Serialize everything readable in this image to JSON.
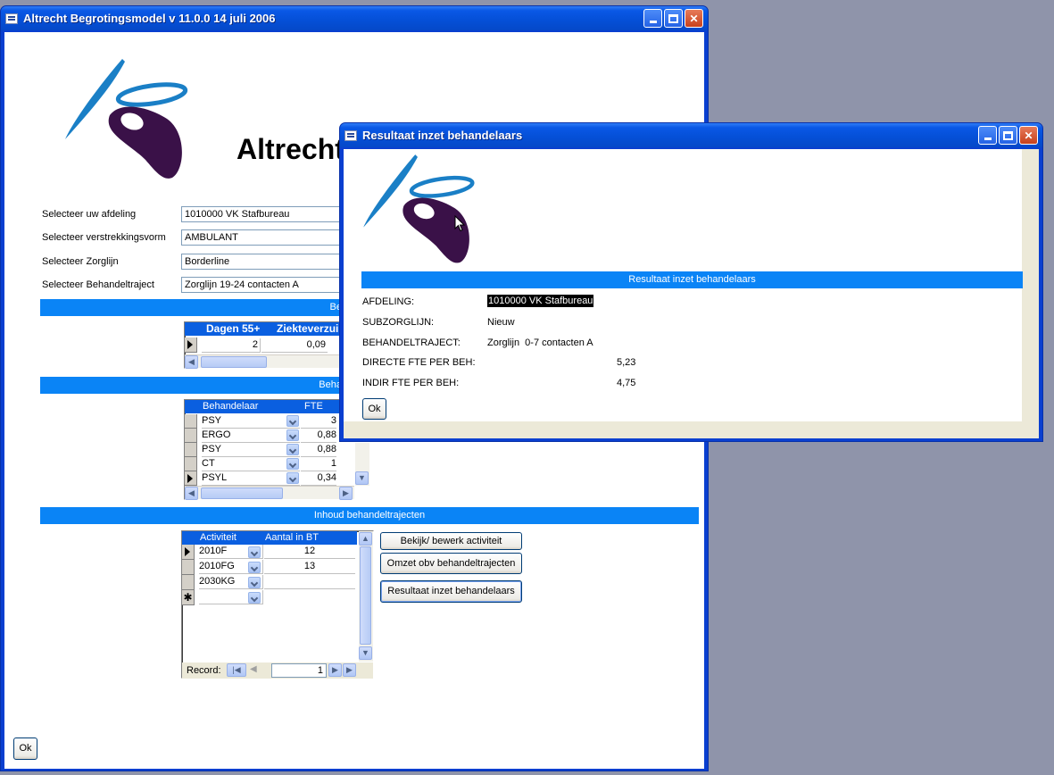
{
  "main_window": {
    "title": "Altrecht Begrotingsmodel v 11.0.0 14 juli 2006",
    "heading": "Altrecht",
    "form": {
      "afdeling_label": "Selecteer uw afdeling",
      "afdeling_value": "1010000 VK Stafbureau",
      "verstrekkingsvorm_label": "Selecteer verstrekkingsvorm",
      "verstrekkingsvorm_value": "AMBULANT",
      "zorglijn_label": "Selecteer Zorglijn",
      "zorglijn_value": "Borderline",
      "behandeltraject_label": "Selecteer Behandeltraject",
      "behandeltraject_value": "Zorglijn  19-24 contacten A"
    },
    "section1_title": "Be",
    "grid1": {
      "headers": [
        "Dagen 55+",
        "Ziekteverzui"
      ],
      "row": [
        "2",
        "0,09"
      ]
    },
    "section2_title": "Beha",
    "grid2": {
      "headers": [
        "Behandelaar",
        "FTE"
      ],
      "rows": [
        {
          "behandelaar": "PSY",
          "fte": "3"
        },
        {
          "behandelaar": "ERGO",
          "fte": "0,88"
        },
        {
          "behandelaar": "PSY",
          "fte": "0,88"
        },
        {
          "behandelaar": "CT",
          "fte": "1"
        },
        {
          "behandelaar": "PSYL",
          "fte": "0,34"
        }
      ]
    },
    "section3_title": "Inhoud behandeltrajecten",
    "grid3": {
      "headers": [
        "Activiteit",
        "Aantal in BT"
      ],
      "rows": [
        {
          "activiteit": "2010F",
          "aantal": "12"
        },
        {
          "activiteit": "2010FG",
          "aantal": "13"
        },
        {
          "activiteit": "2030KG",
          "aantal": ""
        }
      ],
      "new_row_marker": "✱",
      "record_label": "Record:",
      "record_value": "1"
    },
    "buttons": {
      "bekijk": "Bekijk/ bewerk activiteit",
      "omzet": "Omzet obv behandeltrajecten",
      "resultaat": "Resultaat inzet behandelaars",
      "ok": "Ok"
    }
  },
  "dialog": {
    "title": "Resultaat inzet behandelaars",
    "section_title": "Resultaat inzet behandelaars",
    "rows": [
      {
        "label": "AFDELING:",
        "value": "1010000 VK Stafbureau"
      },
      {
        "label": "SUBZORGLIJN:",
        "value": "Nieuw"
      },
      {
        "label": "BEHANDELTRAJECT:",
        "value": "Zorglijn  0-7 contacten A"
      },
      {
        "label": "DIRECTE FTE PER BEH:",
        "value": "5,23"
      },
      {
        "label": "INDIR FTE PER BEH:",
        "value": "4,75"
      }
    ],
    "ok": "Ok"
  },
  "colors": {
    "accent_bar": "#0a84f6",
    "logo_blue": "#1a7fc6",
    "logo_purple": "#3a1148"
  },
  "icons": [
    "app-icon",
    "minimize-icon",
    "maximize-icon",
    "close-icon",
    "record-selector-arrow-icon",
    "dropdown-icon",
    "mouse-cursor-icon"
  ]
}
